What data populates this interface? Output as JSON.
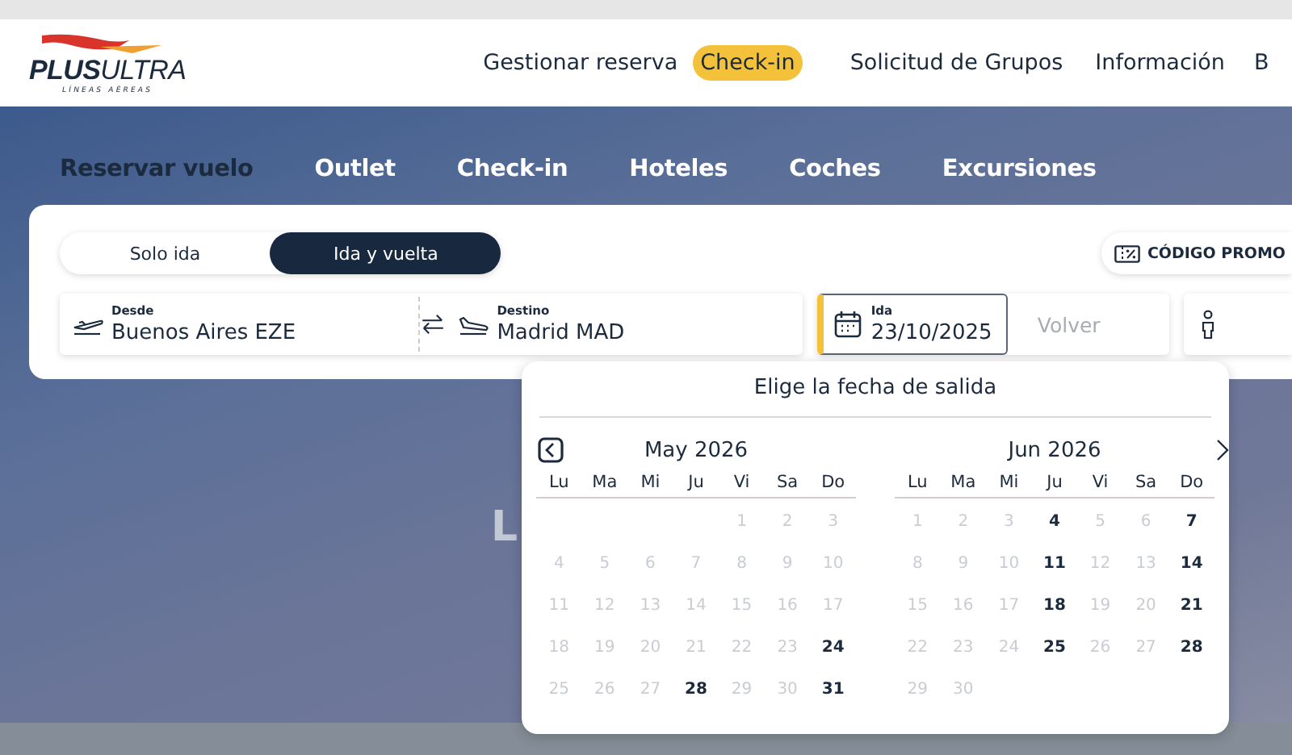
{
  "header": {
    "logo": {
      "bold_part": "PLUS",
      "light_part": "ULTRA",
      "tagline": "LÍNEAS AÉREAS"
    },
    "nav": [
      {
        "label": "Gestionar reserva",
        "highlighted": false
      },
      {
        "label": "Check-in",
        "highlighted": true
      },
      {
        "label": "Solicitud de Grupos",
        "highlighted": false
      },
      {
        "label": "Información",
        "highlighted": false
      },
      {
        "label": "B",
        "highlighted": false
      }
    ]
  },
  "tabs": [
    {
      "label": "Reservar vuelo",
      "selected": true
    },
    {
      "label": "Outlet",
      "selected": false
    },
    {
      "label": "Check-in",
      "selected": false
    },
    {
      "label": "Hoteles",
      "selected": false
    },
    {
      "label": "Coches",
      "selected": false
    },
    {
      "label": "Excursiones",
      "selected": false
    }
  ],
  "trip_type": [
    {
      "label": "Solo ida",
      "selected": false
    },
    {
      "label": "Ida y vuelta",
      "selected": true
    }
  ],
  "promo_button": "CÓDIGO PROMO",
  "origin": {
    "label": "Desde",
    "value": "Buenos Aires EZE"
  },
  "destination": {
    "label": "Destino",
    "value": "Madrid MAD"
  },
  "departure": {
    "label": "Ida",
    "value": "23/10/2025",
    "focused": true
  },
  "return": {
    "placeholder": "Volver"
  },
  "hero_heading": "L",
  "date_picker": {
    "title": "Elige la fecha de salida",
    "months": [
      {
        "title": "May 2026",
        "weekdays": [
          "Lu",
          "Ma",
          "Mi",
          "Ju",
          "Vi",
          "Sa",
          "Do"
        ],
        "weeks": [
          [
            {
              "day": "1",
              "available": false
            },
            {
              "day": "2",
              "available": false
            },
            {
              "day": "3",
              "available": false
            }
          ],
          [
            {
              "day": "4",
              "available": false
            },
            {
              "day": "5",
              "available": false
            },
            {
              "day": "6",
              "available": false
            },
            {
              "day": "7",
              "available": false
            },
            {
              "day": "8",
              "available": false
            },
            {
              "day": "9",
              "available": false
            },
            {
              "day": "10",
              "available": false
            }
          ],
          [
            {
              "day": "11",
              "available": false
            },
            {
              "day": "12",
              "available": false
            },
            {
              "day": "13",
              "available": false
            },
            {
              "day": "14",
              "available": false
            },
            {
              "day": "15",
              "available": false
            },
            {
              "day": "16",
              "available": false
            },
            {
              "day": "17",
              "available": false
            }
          ],
          [
            {
              "day": "18",
              "available": false
            },
            {
              "day": "19",
              "available": false
            },
            {
              "day": "20",
              "available": false
            },
            {
              "day": "21",
              "available": false
            },
            {
              "day": "22",
              "available": false
            },
            {
              "day": "23",
              "available": false
            },
            {
              "day": "24",
              "available": true
            }
          ],
          [
            {
              "day": "25",
              "available": false
            },
            {
              "day": "26",
              "available": false
            },
            {
              "day": "27",
              "available": false
            },
            {
              "day": "28",
              "available": true
            },
            {
              "day": "29",
              "available": false
            },
            {
              "day": "30",
              "available": false
            },
            {
              "day": "31",
              "available": true
            }
          ]
        ]
      },
      {
        "title": "Jun 2026",
        "weekdays": [
          "Lu",
          "Ma",
          "Mi",
          "Ju",
          "Vi",
          "Sa",
          "Do"
        ],
        "weeks": [
          [
            {
              "day": "1",
              "available": false
            },
            {
              "day": "2",
              "available": false
            },
            {
              "day": "3",
              "available": false
            },
            {
              "day": "4",
              "available": true
            },
            {
              "day": "5",
              "available": false
            },
            {
              "day": "6",
              "available": false
            },
            {
              "day": "7",
              "available": true
            }
          ],
          [
            {
              "day": "8",
              "available": false
            },
            {
              "day": "9",
              "available": false
            },
            {
              "day": "10",
              "available": false
            },
            {
              "day": "11",
              "available": true
            },
            {
              "day": "12",
              "available": false
            },
            {
              "day": "13",
              "available": false
            },
            {
              "day": "14",
              "available": true
            }
          ],
          [
            {
              "day": "15",
              "available": false
            },
            {
              "day": "16",
              "available": false
            },
            {
              "day": "17",
              "available": false
            },
            {
              "day": "18",
              "available": true
            },
            {
              "day": "19",
              "available": false
            },
            {
              "day": "20",
              "available": false
            },
            {
              "day": "21",
              "available": true
            }
          ],
          [
            {
              "day": "22",
              "available": false
            },
            {
              "day": "23",
              "available": false
            },
            {
              "day": "24",
              "available": false
            },
            {
              "day": "25",
              "available": true
            },
            {
              "day": "26",
              "available": false
            },
            {
              "day": "27",
              "available": false
            },
            {
              "day": "28",
              "available": true
            }
          ],
          [
            {
              "day": "29",
              "available": false
            },
            {
              "day": "30",
              "available": false
            }
          ]
        ]
      }
    ]
  }
}
